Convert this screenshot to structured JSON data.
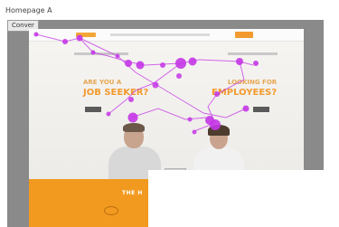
{
  "header": {
    "title": "Homepage A",
    "tab_label": "Conver"
  },
  "website": {
    "left_hero": {
      "line1": "Are you a",
      "line2": "Job Seeker?"
    },
    "right_hero": {
      "line1": "Looking for",
      "line2": "Employees?"
    },
    "bottom_heading": "THE H"
  },
  "gaze_overlay": {
    "color": "#c436e6"
  }
}
